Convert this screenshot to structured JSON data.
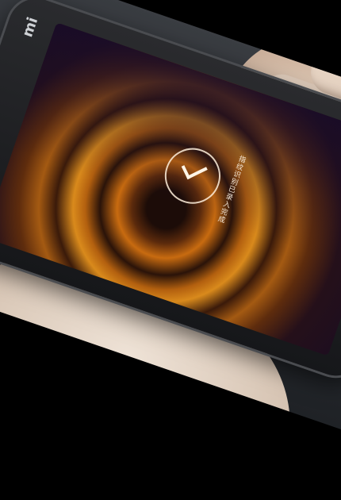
{
  "image": {
    "logo_text": "mi",
    "screen_status": "指纹识别已录入完成",
    "icons": [
      "check-icon"
    ],
    "colors": {
      "screen_glow": "#d98a1c",
      "screen_dark": "#190d22",
      "phone_body": "#1f2023"
    }
  }
}
